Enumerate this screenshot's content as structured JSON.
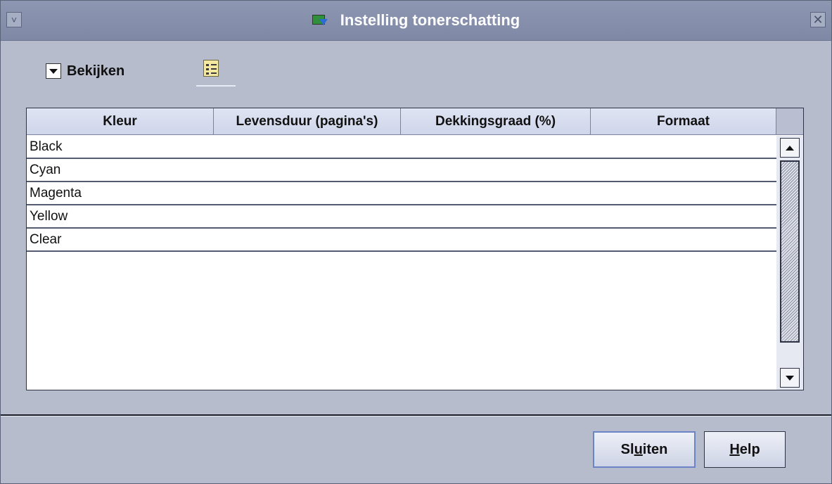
{
  "window": {
    "title": "Instelling tonerschatting",
    "menu_glyph": "˅",
    "close_glyph": "✕"
  },
  "toolbar": {
    "view_label": "Bekijken"
  },
  "table": {
    "columns": [
      "Kleur",
      "Levensduur (pagina's)",
      "Dekkingsgraad (%)",
      "Formaat"
    ],
    "rows": [
      [
        "Black",
        "",
        "",
        ""
      ],
      [
        "Cyan",
        "",
        "",
        ""
      ],
      [
        "Magenta",
        "",
        "",
        ""
      ],
      [
        "Yellow",
        "",
        "",
        ""
      ],
      [
        "Clear",
        "",
        "",
        ""
      ]
    ]
  },
  "buttons": {
    "close_pre": "Sl",
    "close_mnemonic": "u",
    "close_post": "iten",
    "help_mnemonic": "H",
    "help_post": "elp"
  },
  "colors": {
    "titlebar": "#8a94af",
    "body": "#b7bccd",
    "header": "#d6dcee"
  }
}
